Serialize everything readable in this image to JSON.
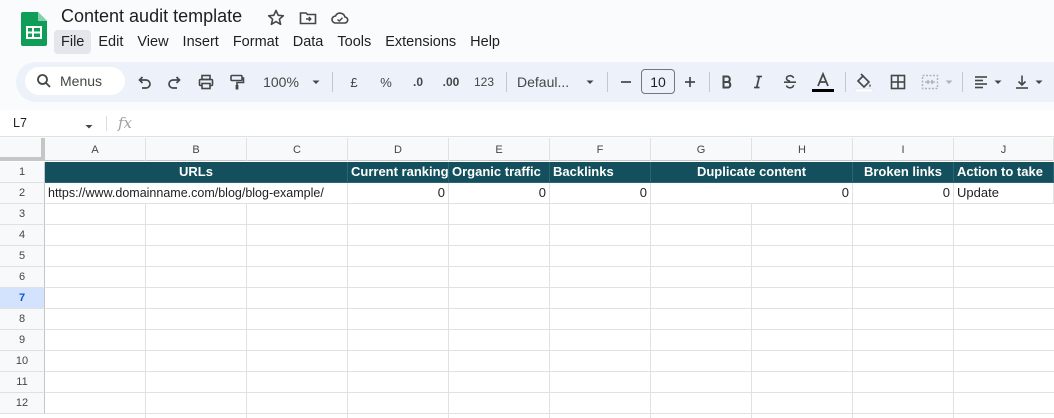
{
  "doc": {
    "title": "Content audit template"
  },
  "menu": [
    "File",
    "Edit",
    "View",
    "Insert",
    "Format",
    "Data",
    "Tools",
    "Extensions",
    "Help"
  ],
  "toolbar": {
    "search_placeholder": "Menus",
    "zoom": "100%",
    "currency": "£",
    "percent": "%",
    "decrease_decimal": ".0",
    "increase_decimal": ".00",
    "number_format": "123",
    "font": "Defaul...",
    "font_size": "10"
  },
  "formula_bar": {
    "name_box": "L7",
    "fx": "fx"
  },
  "colors": {
    "header_fill": "#134f5c",
    "selected_row": "#d3e3fd",
    "logo_green": "#0f9d58"
  },
  "sheet": {
    "columns": [
      "A",
      "B",
      "C",
      "D",
      "E",
      "F",
      "G",
      "H",
      "I",
      "J"
    ],
    "rows": [
      "1",
      "2",
      "3",
      "4",
      "5",
      "6",
      "7",
      "8",
      "9",
      "10",
      "11",
      "12"
    ],
    "selected_row": "7",
    "header": {
      "urls": "URLs",
      "current_ranking": "Current ranking",
      "organic_traffic": "Organic traffic",
      "backlinks": "Backlinks",
      "duplicate_content": "Duplicate content",
      "broken_links": "Broken links",
      "action": "Action to take"
    },
    "row2": {
      "url": "https://www.domainname.com/blog/blog-example/",
      "current_ranking": "0",
      "organic_traffic": "0",
      "backlinks": "0",
      "duplicate_content": "0",
      "broken_links": "0",
      "action": "Update"
    }
  }
}
